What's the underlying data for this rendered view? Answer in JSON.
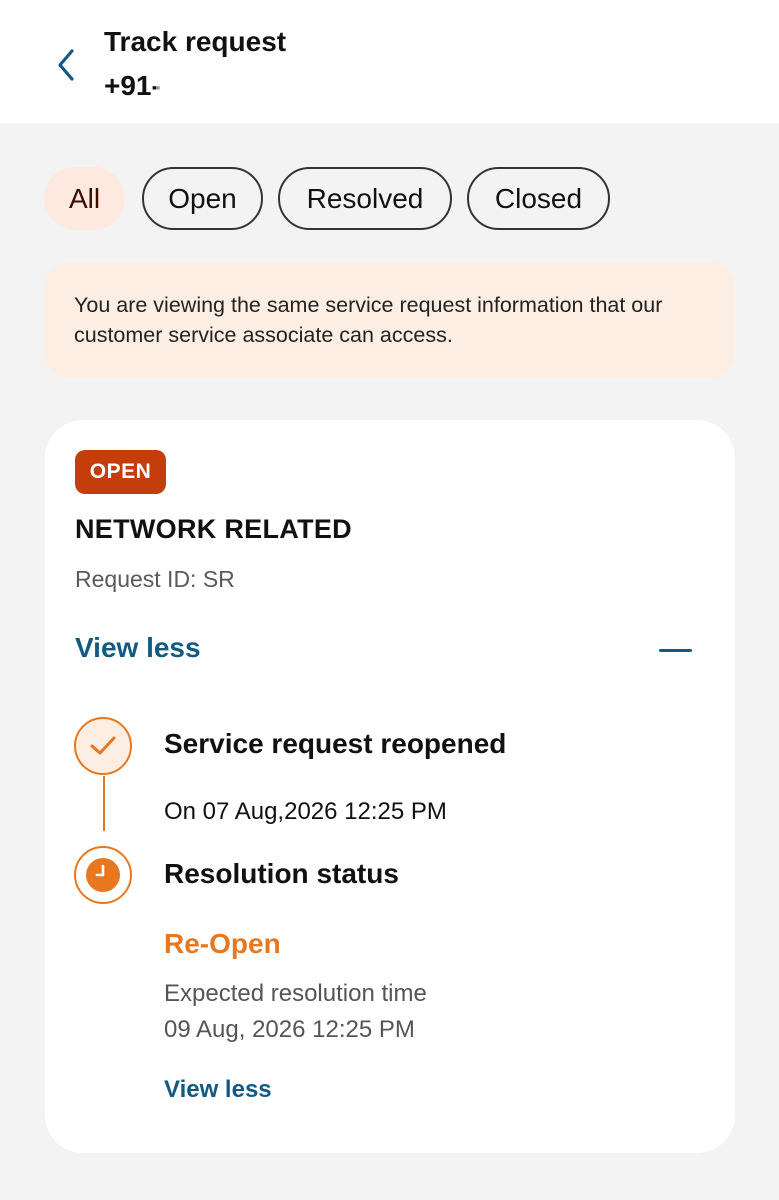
{
  "header": {
    "title": "Track request",
    "subtitle": "+91-"
  },
  "filters": [
    {
      "label": "All",
      "active": true
    },
    {
      "label": "Open",
      "active": false
    },
    {
      "label": "Resolved",
      "active": false
    },
    {
      "label": "Closed",
      "active": false
    }
  ],
  "notice": {
    "text": "You are viewing the same service request information that our customer service associate can access."
  },
  "request": {
    "status_badge": "OPEN",
    "category": "NETWORK RELATED",
    "request_id_label": "Request ID: SR",
    "toggle_label": "View less",
    "timeline": {
      "step1": {
        "title": "Service request reopened",
        "date": "On 07 Aug,2026 12:25 PM"
      },
      "step2": {
        "title": "Resolution status",
        "status": "Re-Open",
        "expected_label": "Expected resolution time",
        "expected_value": "09 Aug, 2026 12:25 PM",
        "toggle_label": "View less"
      }
    }
  },
  "colors": {
    "accent_orange": "#e8781f",
    "badge_red": "#c43e0c",
    "link_blue": "#135a82",
    "notice_bg": "#fdeee4"
  },
  "icons": {
    "back": "chevron-left-icon",
    "collapse": "minus-icon",
    "step1": "checkmark-icon",
    "step2": "clock-icon"
  }
}
